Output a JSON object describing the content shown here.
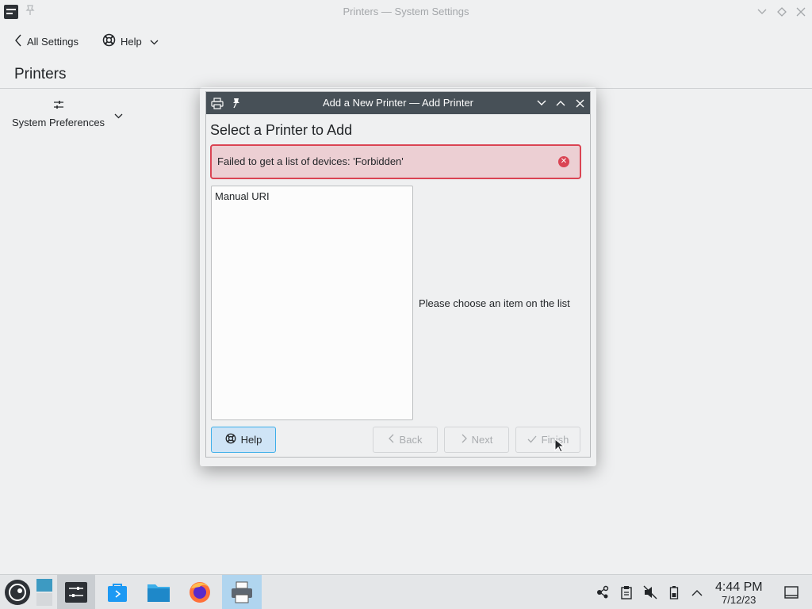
{
  "window": {
    "title": "Printers — System Settings",
    "app_icon": "system-settings-icon",
    "pin_icon": "pin-icon"
  },
  "toolbar": {
    "all_settings_label": "All Settings",
    "help_label": "Help"
  },
  "page": {
    "title": "Printers"
  },
  "sidebar": {
    "system_preferences_label": "System Preferences"
  },
  "dialog": {
    "title": "Add a New Printer — Add Printer",
    "heading": "Select a Printer to Add",
    "error_message": "Failed to get a list of devices: 'Forbidden'",
    "list_items": [
      "Manual URI"
    ],
    "hint": "Please choose an item on the list",
    "buttons": {
      "help": "Help",
      "back": "Back",
      "next": "Next",
      "finish": "Finish"
    },
    "colors": {
      "titlebar": "#475057",
      "error_border": "#da4453",
      "error_bg": "#eccfd3",
      "accent": "#3daee9"
    }
  },
  "taskbar": {
    "apps": [
      "app-launcher-icon",
      "virtual-desktop-pager-icon",
      "system-settings-task-icon",
      "discover-store-icon",
      "file-manager-icon",
      "firefox-icon",
      "printer-task-icon"
    ],
    "tray": [
      "network-icon",
      "clipboard-icon",
      "volume-muted-icon",
      "battery-icon",
      "expand-tray-icon"
    ],
    "clock_time": "4:44 PM",
    "clock_date": "7/12/23"
  }
}
